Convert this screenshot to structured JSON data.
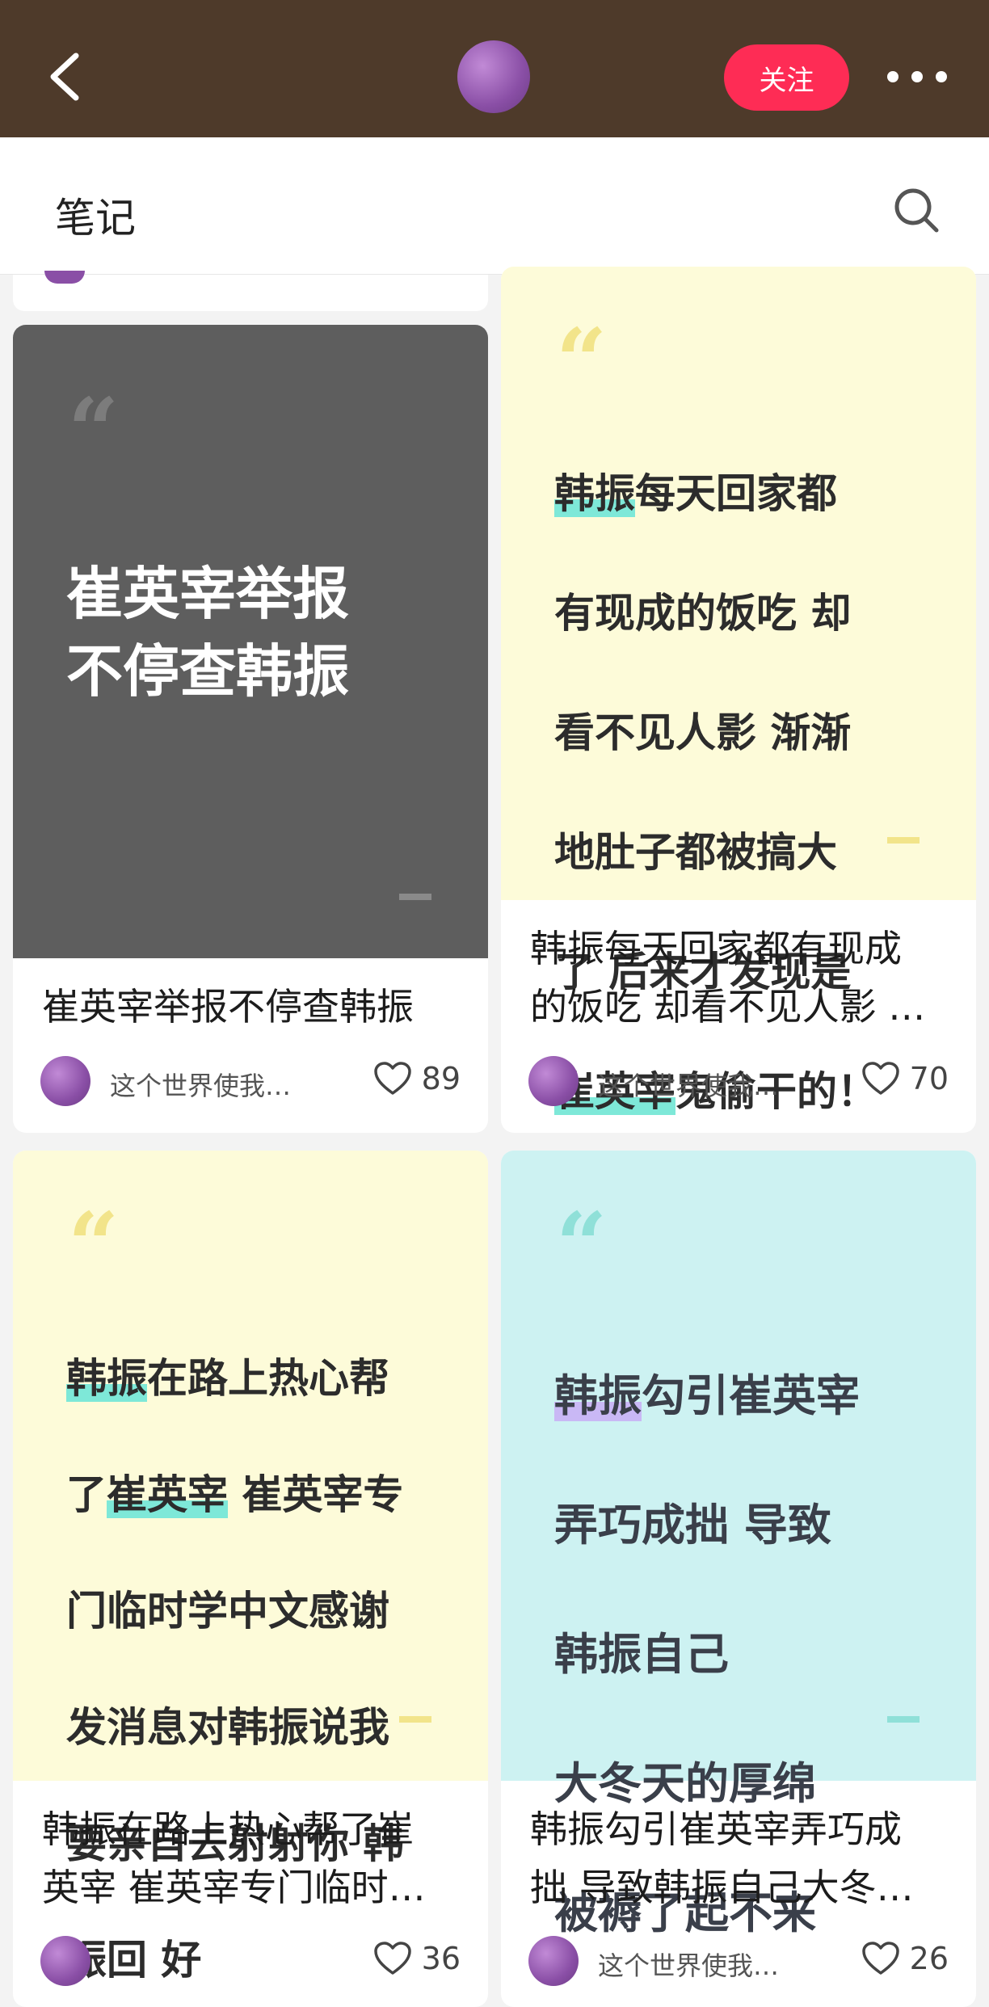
{
  "header": {
    "follow_label": "关注",
    "subtitle": "笔记"
  },
  "cards": [
    {
      "cover_text_plain": "崔英宰举报\n不停查韩振",
      "caption": "崔英宰举报不停查韩振",
      "author": "这个世界使我…",
      "likes": "89"
    },
    {
      "cover_lines": [
        "韩振每天回家都",
        "有现成的饭吃 却",
        "看不见人影 渐渐",
        "地肚子都被搞大",
        "了 后来才发现是",
        "崔英宰鬼偷干的！"
      ],
      "caption": "韩振每天回家都有现成\n的饭吃 却看不见人影 …",
      "author": "这个世界使我…",
      "likes": "70"
    },
    {
      "cover_lines": [
        "韩振在路上热心帮",
        "了崔英宰 崔英宰专",
        "门临时学中文感谢",
        "发消息对韩振说我",
        "要亲自去射射你 韩",
        "振回 好"
      ],
      "caption": "韩振在路上热心帮了崔\n英宰 崔英宰专门临时…",
      "author": "",
      "likes": "36"
    },
    {
      "cover_lines": [
        "韩振勾引崔英宰",
        "弄巧成拙 导致",
        "韩振自己",
        "大冬天的厚绵",
        "被褥了起不来"
      ],
      "caption": "韩振勾引崔英宰弄巧成\n拙 导致韩振自己大冬…",
      "author": "这个世界使我…",
      "likes": "26"
    }
  ],
  "colors": {
    "topbar": "#4e3a2a",
    "follow": "#fe2c55",
    "card1_bg": "#5e5e5e",
    "yellow_bg": "#fdfbd9",
    "teal_bg": "#cdf2f2",
    "highlight_teal": "#7ee8d8",
    "highlight_purple": "#c9b8f5"
  },
  "icons": [
    "back-arrow-icon",
    "more-dots-icon",
    "search-icon",
    "heart-icon",
    "quote-mark-icon"
  ]
}
